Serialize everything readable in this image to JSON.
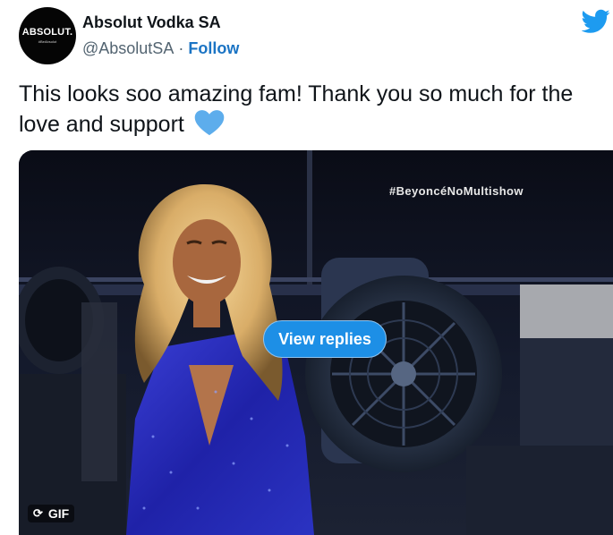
{
  "tweet": {
    "author": {
      "display_name": "Absolut Vodka SA",
      "handle": "@AbsolutSA",
      "separator": "·",
      "follow_label": "Follow",
      "avatar_text": "ABSOLUT.",
      "avatar_subtext": "#BeAbsolut"
    },
    "text": "This looks soo amazing fam! Thank you so much for the love and support",
    "emoji": "blue-heart-icon",
    "media": {
      "overlay_text": "#BeyoncéNoMultishow",
      "view_replies_label": "View replies",
      "badge_label": "GIF"
    }
  },
  "colors": {
    "follow": "#1b74c4",
    "twitter_blue": "#1d9bf0",
    "heart": "#5dadec",
    "button": "#1d8fe6"
  },
  "icons": [
    "twitter-bird-icon",
    "blue-heart-icon",
    "gif-loop-icon"
  ]
}
